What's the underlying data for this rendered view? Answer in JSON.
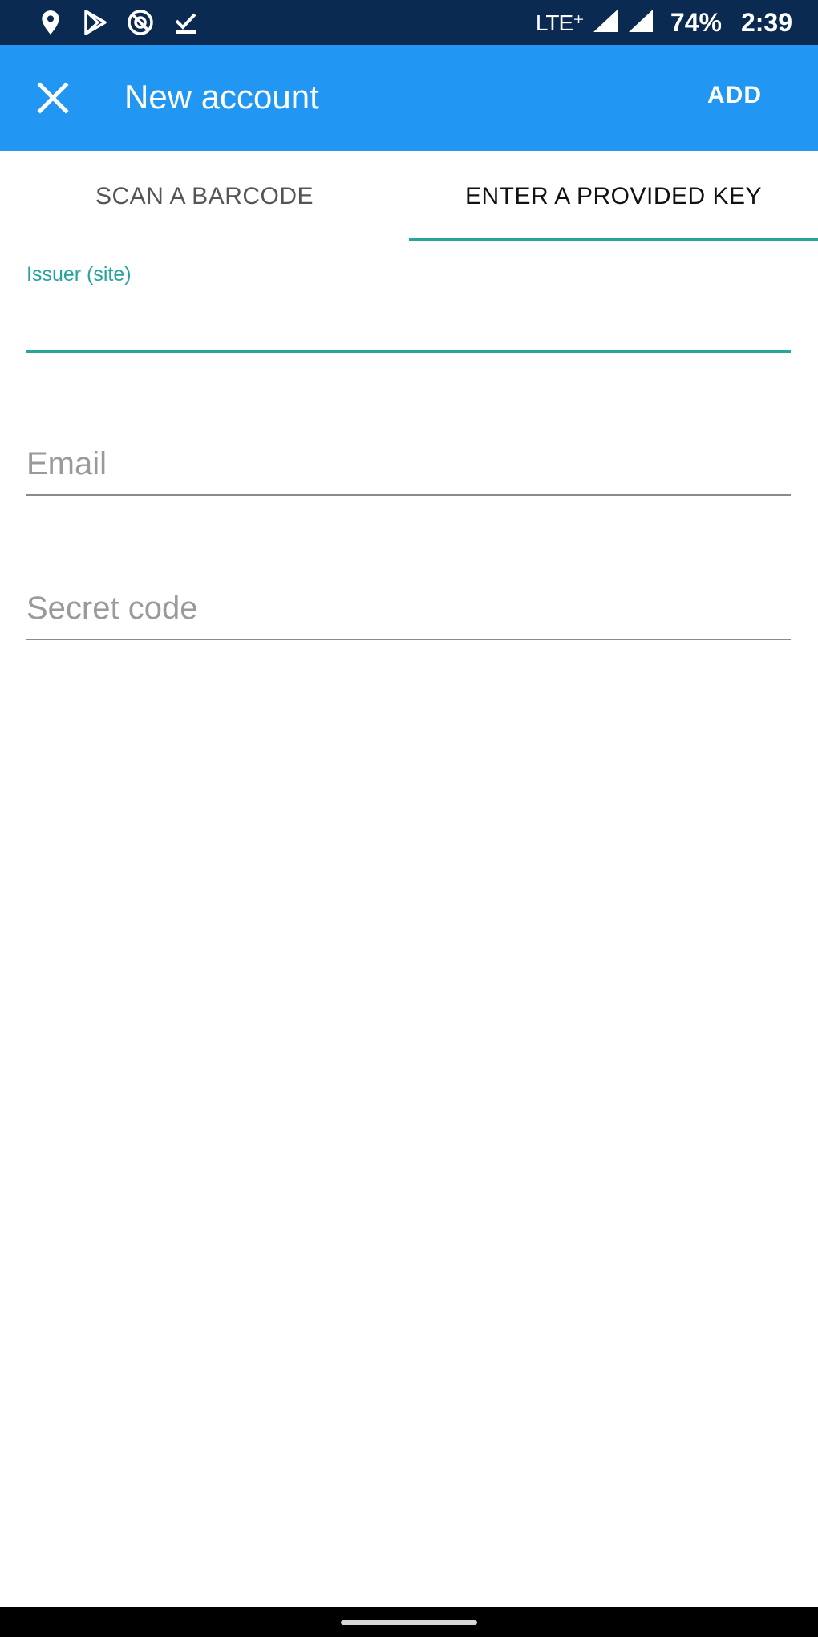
{
  "status_bar": {
    "icons": [
      "location-icon",
      "play-store-icon",
      "vpn-icon",
      "download-done-icon"
    ],
    "network": "LTE⁺",
    "battery": "74%",
    "time": "2:39"
  },
  "app_bar": {
    "close_icon": "close-icon",
    "title": "New account",
    "add_label": "ADD"
  },
  "tabs": [
    {
      "label": "SCAN A BARCODE",
      "selected": false
    },
    {
      "label": "ENTER A PROVIDED KEY",
      "selected": true
    }
  ],
  "form": {
    "issuer": {
      "label": "Issuer (site)",
      "value": ""
    },
    "email": {
      "placeholder": "Email",
      "value": ""
    },
    "secret": {
      "placeholder": "Secret code",
      "value": ""
    }
  },
  "colors": {
    "status_bar": "#0b2a52",
    "app_bar": "#2196f3",
    "accent": "#26a69a",
    "nav_bar": "#000000"
  }
}
